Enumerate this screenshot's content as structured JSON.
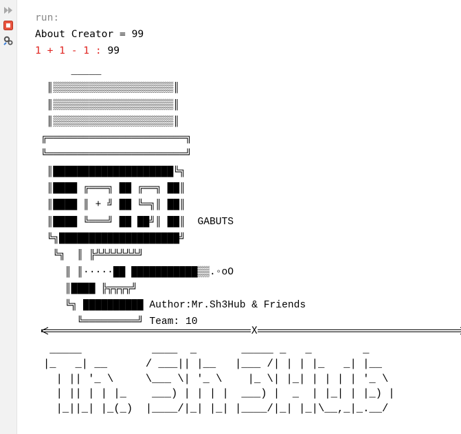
{
  "toolbar": {
    "icons": [
      "rerun-icon",
      "stop-icon",
      "settings-icon"
    ],
    "colors": {
      "rerun": "#3d9b3d",
      "stop": "#e0231f",
      "settings": "#555555"
    }
  },
  "console": {
    "run_label": "run:",
    "about_line": "About Creator = 99",
    "calc_prefix": "1 + 1 - 1 :",
    "calc_result": " 99",
    "art_lines": [
      "      _____",
      "  ║▒▒▒▒▒▒▒▒▒▒▒▒▒▒▒▒▒▒▒▒║",
      "  ║▒▒▒▒▒▒▒▒▒▒▒▒▒▒▒▒▒▒▒▒║",
      "  ║▒▒▒▒▒▒▒▒▒▒▒▒▒▒▒▒▒▒▒▒║",
      " ╔═══════════════════════╗",
      " ╚═══════════════════════╝",
      "  ║████████████████████╚╗",
      "  ║████ ╔═══╗ ██ ╔══╗ ██║",
      "  ║████ ║ + ╝ ██ ╚═╗║ ██║",
      "  ║████ ╚═══╝ ██ ██╝║ ██║  GABUTS",
      "  ╚╗████████████████████╝",
      "   ╚╗  ║ ╠╩╩╩╩╩╩╩╝",
      "     ║ ║·····██ ███████████▒▒.◦oO",
      "     ║████ ╠╦╦╦╦╝",
      "     ╚╗ ██████████ Author:Mr.Sh3Hub & Friends",
      "       ╚═════════╝ Team: 10"
    ],
    "separator_mark": "X",
    "banner_lines": [
      " _____           ____  _       _____ _   _        _",
      "|_   _| __      / ___|| |__   |___ /| | | |_   _| |__",
      "  | || '_ \\     \\___ \\| '_ \\    |_ \\| |_| | | | | '_ \\",
      "  | || | | |_    ___) | | | |  ___) |  _  | |_| | |_) |",
      "  |_||_| |_(_)  |____/|_| |_| |____/|_| |_|\\__,_|_.__/"
    ]
  }
}
